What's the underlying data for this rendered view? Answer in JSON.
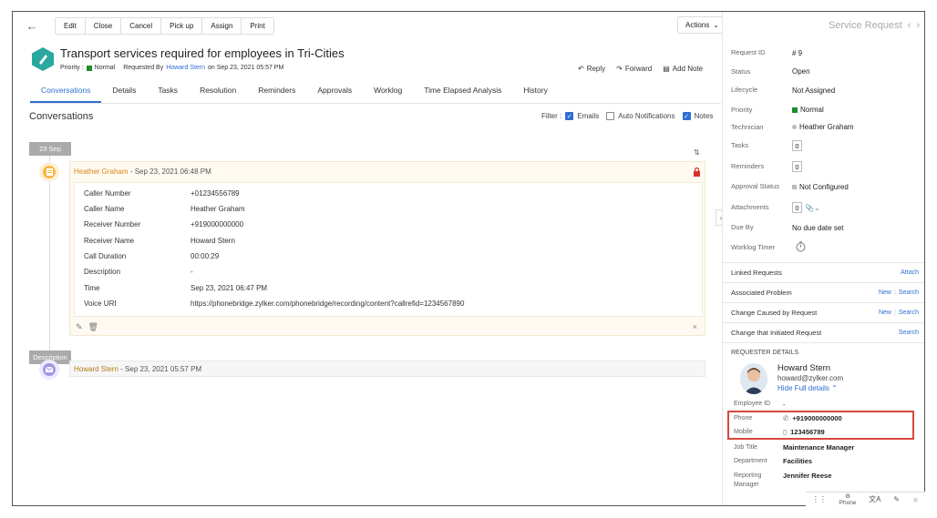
{
  "toolbar": {
    "buttons": [
      "Edit",
      "Close",
      "Cancel",
      "Pick up",
      "Assign",
      "Print"
    ],
    "actions_label": "Actions"
  },
  "request": {
    "title": "Transport services required for employees in Tri-Cities",
    "priority_label": "Priority :",
    "priority_value": "Normal",
    "requested_by_label": "Requested By",
    "requester": "Howard Stern",
    "on_date": "on Sep 23, 2021 05:57 PM"
  },
  "title_actions": {
    "reply": "Reply",
    "forward": "Forward",
    "add_note": "Add Note"
  },
  "tabs": [
    "Conversations",
    "Details",
    "Tasks",
    "Resolution",
    "Reminders",
    "Approvals",
    "Worklog",
    "Time Elapsed Analysis",
    "History"
  ],
  "conversations": {
    "heading": "Conversations",
    "filter_label": "Filter :",
    "filters": [
      {
        "label": "Emails",
        "checked": true
      },
      {
        "label": "Auto Notifications",
        "checked": false
      },
      {
        "label": "Notes",
        "checked": true
      }
    ],
    "date_pill": "23 Sep",
    "note": {
      "author": "Heather Graham",
      "time": "- Sep 23, 2021 06:48 PM",
      "fields": [
        {
          "k": "Caller Number",
          "v": "+01234556789"
        },
        {
          "k": "Caller Name",
          "v": "Heather Graham"
        },
        {
          "k": "Receiver Number",
          "v": "+919000000000"
        },
        {
          "k": "Receiver Name",
          "v": "Howard Stern"
        },
        {
          "k": "Call Duration",
          "v": "00:00:29"
        },
        {
          "k": "Description",
          "v": "-"
        },
        {
          "k": "Time",
          "v": "Sep 23, 2021 06:47 PM"
        },
        {
          "k": "Voice URI",
          "v": "https://phonebridge.zylker.com/phonebridge/recording/content?callrefid=1234567890"
        }
      ]
    },
    "desc_pill": "Description",
    "desc": {
      "author": "Howard Stern",
      "time": "- Sep 23, 2021 05:57 PM"
    }
  },
  "right_panel": {
    "header_title": "Service Request",
    "props": [
      {
        "k": "Request ID",
        "v": "# 9"
      },
      {
        "k": "Status",
        "v": "Open"
      },
      {
        "k": "Lifecycle",
        "v": "Not Assigned"
      },
      {
        "k": "Priority",
        "v": "Normal"
      },
      {
        "k": "Technician",
        "v": "Heather Graham"
      },
      {
        "k": "Tasks",
        "v": "0"
      },
      {
        "k": "Reminders",
        "v": "0"
      },
      {
        "k": "Approval Status",
        "v": "Not Configured"
      },
      {
        "k": "Attachments",
        "v": "0"
      },
      {
        "k": "Due By",
        "v": "No due date set"
      },
      {
        "k": "Worklog Timer",
        "v": ""
      }
    ],
    "sections": [
      {
        "label": "Linked Requests",
        "links": [
          "Attach"
        ]
      },
      {
        "label": "Associated Problem",
        "links": [
          "New",
          "Search"
        ]
      },
      {
        "label": "Change Caused by Request",
        "links": [
          "New",
          "Search"
        ]
      },
      {
        "label": "Change that Initiated Request",
        "links": [
          "Search"
        ]
      }
    ],
    "requester_details_label": "REQUESTER DETAILS",
    "requester": {
      "name": "Howard Stern",
      "email": "howard@zylker.com",
      "hide_label": "Hide Full details",
      "details": [
        {
          "k": "Employee ID",
          "v": "-"
        },
        {
          "k": "Phone",
          "v": "+919000000000"
        },
        {
          "k": "Mobile",
          "v": "123456789"
        },
        {
          "k": "Job Title",
          "v": "Maintenance Manager"
        },
        {
          "k": "Department",
          "v": "Facilities"
        },
        {
          "k": "Reporting Manager",
          "v": "Jennifer Reese"
        }
      ]
    }
  },
  "bottom_bar": {
    "phone_label": "Phone"
  },
  "colors": {
    "accent": "#2f6fd1",
    "priority_green": "#1a8f2e",
    "note_orange": "#d88a17",
    "highlight_red": "#d7473f"
  }
}
